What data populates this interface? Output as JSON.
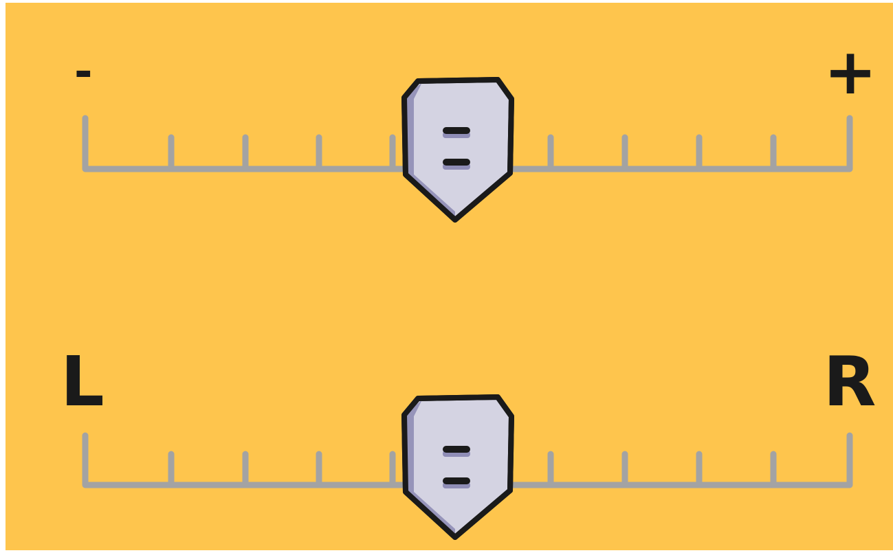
{
  "colors": {
    "background": "#fec54d",
    "track": "#a3a3a3",
    "thumb_fill": "#d4d3e2",
    "thumb_shadow": "#8f8db6",
    "outline": "#1a1a1a"
  },
  "sliders": [
    {
      "id": "top",
      "min_label": "-",
      "max_label": "+",
      "thumb_symbol": "=",
      "value": 0.5,
      "tick_count": 11
    },
    {
      "id": "bottom",
      "min_label": "L",
      "max_label": "R",
      "thumb_symbol": "=",
      "value": 0.5,
      "tick_count": 11
    }
  ]
}
